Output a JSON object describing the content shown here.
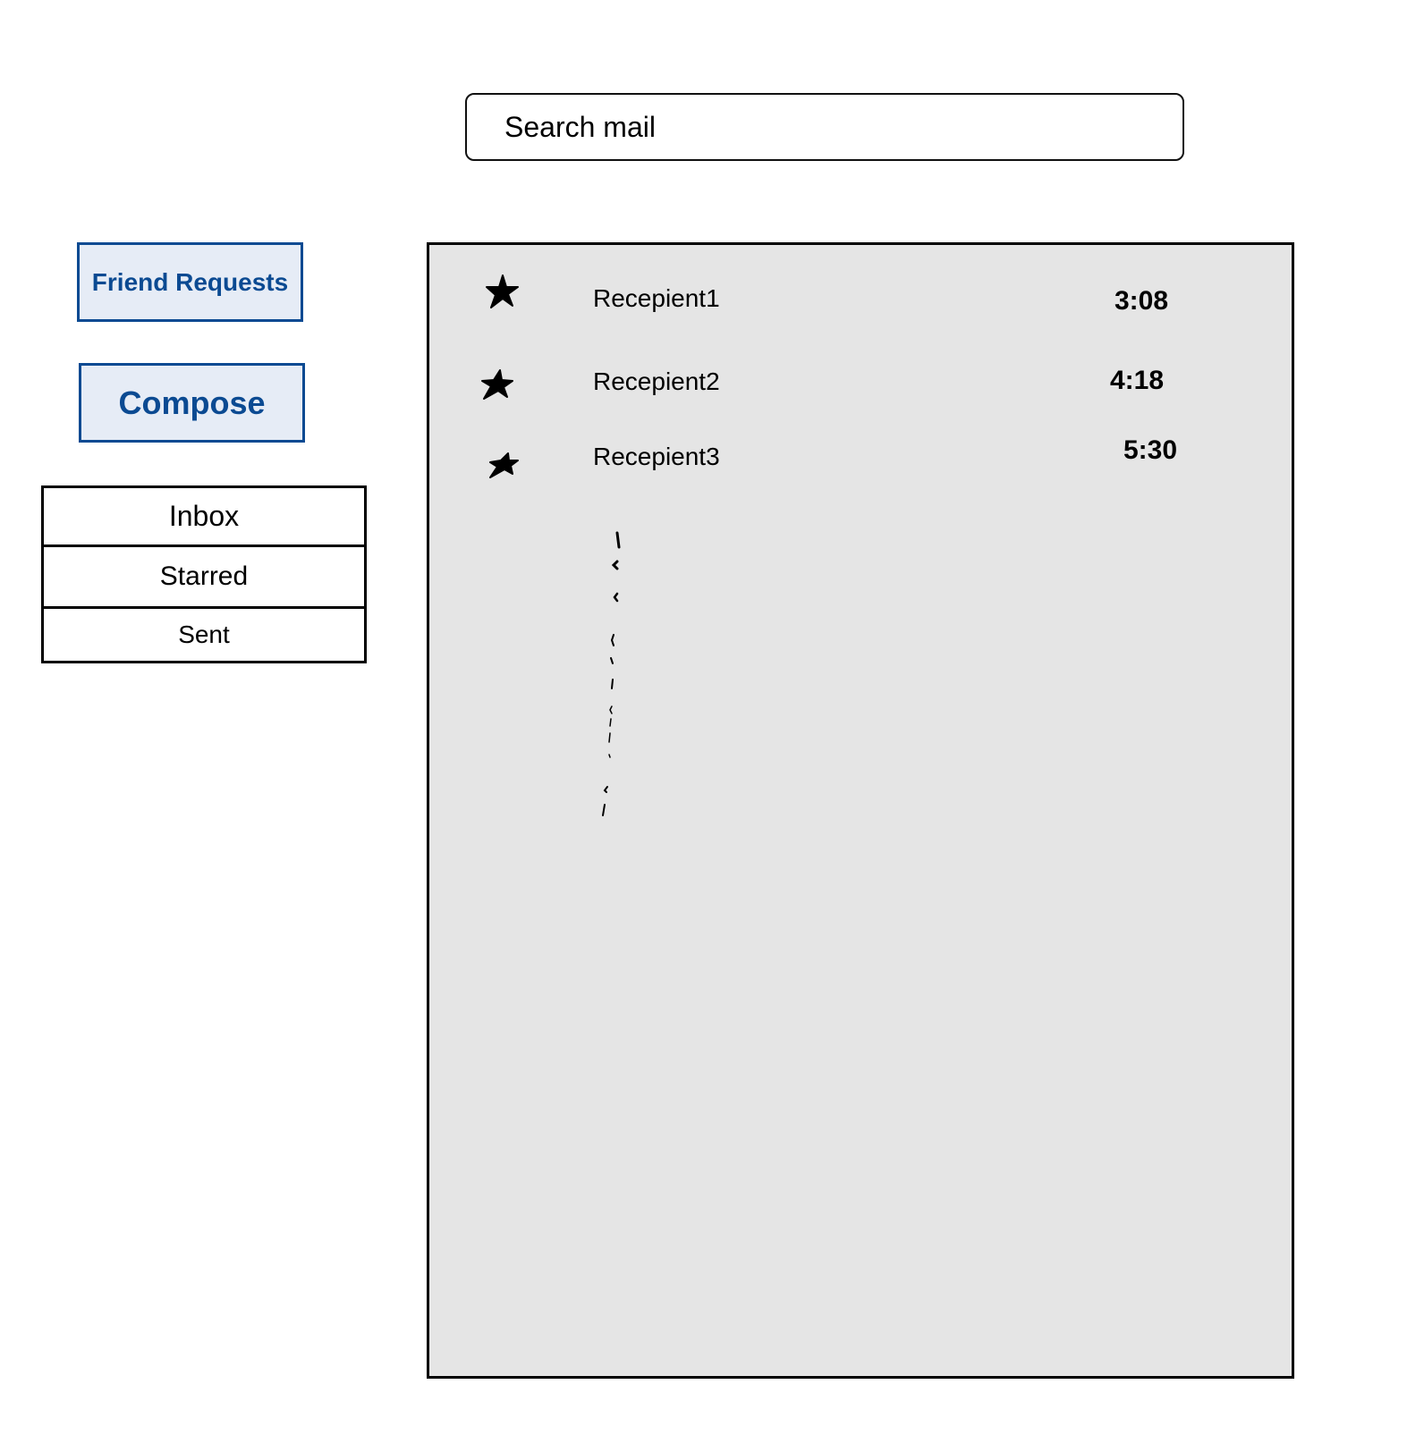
{
  "search": {
    "placeholder": "Search mail"
  },
  "sidebar": {
    "friend_requests_label": "Friend Requests",
    "compose_label": "Compose",
    "folders": [
      {
        "label": "Inbox"
      },
      {
        "label": "Starred"
      },
      {
        "label": "Sent"
      }
    ]
  },
  "mail": {
    "rows": [
      {
        "recipient": "Recepient1",
        "time": "3:08",
        "starred": true,
        "icon": "star-icon"
      },
      {
        "recipient": "Recepient2",
        "time": "4:18",
        "starred": true,
        "icon": "star-icon"
      },
      {
        "recipient": "Recepient3",
        "time": "5:30",
        "starred": true,
        "icon": "star-icon"
      }
    ]
  },
  "colors": {
    "accent": "#0b4a92",
    "button_fill": "#e6ecf6",
    "panel_fill": "#e5e5e5"
  }
}
